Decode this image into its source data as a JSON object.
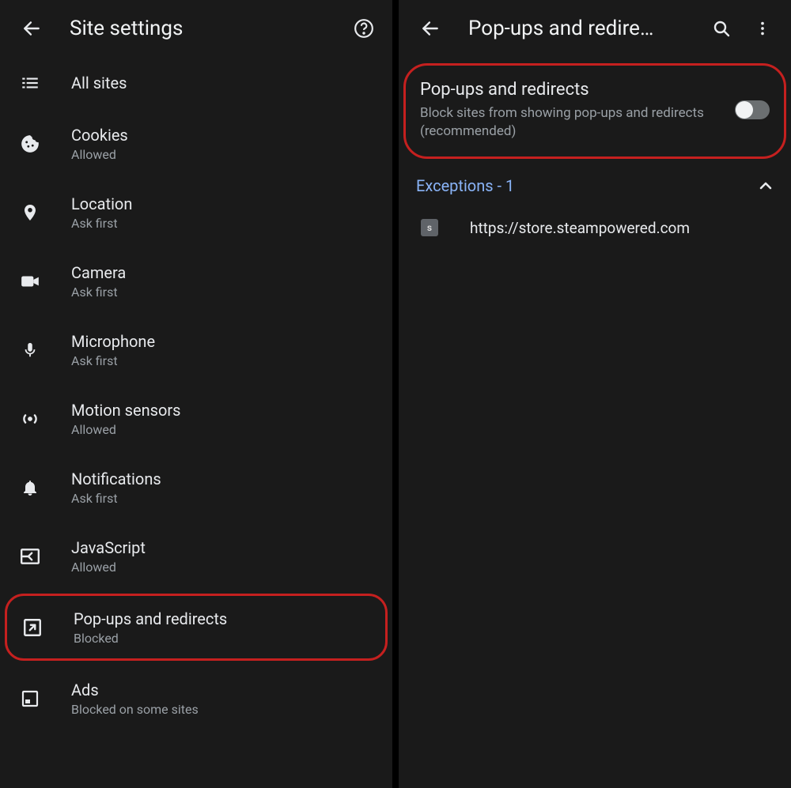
{
  "left": {
    "header": {
      "title": "Site settings"
    },
    "items": [
      {
        "id": "all-sites",
        "label": "All sites",
        "sub": "",
        "icon": "list"
      },
      {
        "id": "cookies",
        "label": "Cookies",
        "sub": "Allowed",
        "icon": "cookie"
      },
      {
        "id": "location",
        "label": "Location",
        "sub": "Ask first",
        "icon": "location"
      },
      {
        "id": "camera",
        "label": "Camera",
        "sub": "Ask first",
        "icon": "camera"
      },
      {
        "id": "microphone",
        "label": "Microphone",
        "sub": "Ask first",
        "icon": "mic"
      },
      {
        "id": "motion",
        "label": "Motion sensors",
        "sub": "Allowed",
        "icon": "motion"
      },
      {
        "id": "notifications",
        "label": "Notifications",
        "sub": "Ask first",
        "icon": "bell"
      },
      {
        "id": "javascript",
        "label": "JavaScript",
        "sub": "Allowed",
        "icon": "javascript"
      },
      {
        "id": "popups",
        "label": "Pop-ups and redirects",
        "sub": "Blocked",
        "icon": "popup",
        "highlighted": true
      },
      {
        "id": "ads",
        "label": "Ads",
        "sub": "Blocked on some sites",
        "icon": "ads"
      }
    ]
  },
  "right": {
    "header": {
      "title": "Pop-ups and redire…"
    },
    "toggle": {
      "title": "Pop-ups and redirects",
      "sub": "Block sites from showing pop-ups and redirects (recommended)",
      "state": "off"
    },
    "exceptions": {
      "label": "Exceptions - 1",
      "expanded": true,
      "items": [
        {
          "favicon_letter": "s",
          "url": "https://store.steampowered.com"
        }
      ]
    }
  }
}
